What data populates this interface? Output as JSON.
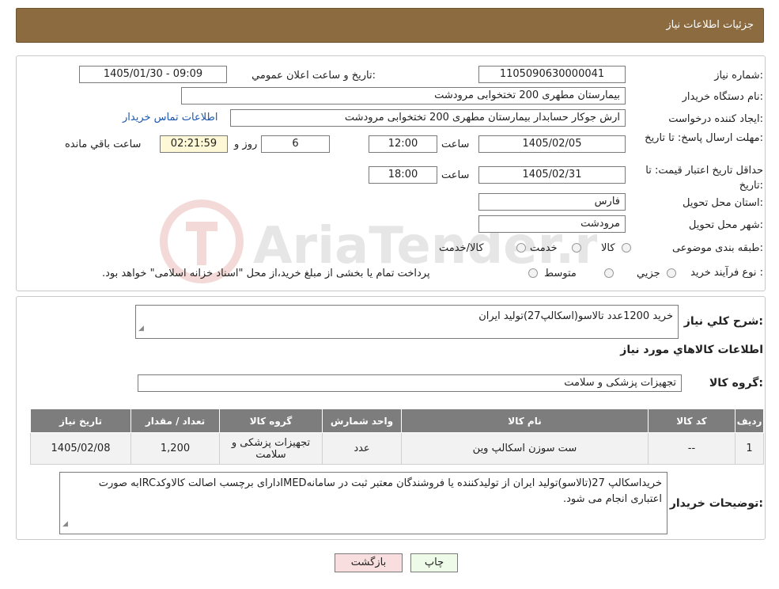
{
  "header": {
    "title": "جزئیات اطلاعات نیاز"
  },
  "form": {
    "need_number_label": "شماره نیاز:",
    "need_number": "1105090630000041",
    "announce_label": "تاریخ و ساعت اعلان عمومي:",
    "announce_value": "1405/01/30 - 09:09",
    "buyer_org_label": "نام دستگاه خريدار:",
    "buyer_org": "بیمارستان مطهری  200 تختخوابی مرودشت",
    "creator_label": "ايجاد كننده درخواست:",
    "creator": "ارش  جوکار حسابدار بیمارستان مطهری  200 تختخوابی مرودشت",
    "contact_link": "اطلاعات تماس خريدار",
    "deadline_label": "مهلت ارسال پاسخ: تا تاريخ:",
    "deadline_date": "1405/02/05",
    "time_label": "ساعت",
    "deadline_time": "12:00",
    "days_value": "6",
    "days_label": "روز و",
    "remaining_time": "02:21:59",
    "remaining_label": "ساعت باقي مانده",
    "validity_label": "حداقل تاريخ اعتبار قيمت: تا تاريخ:",
    "validity_date": "1405/02/31",
    "validity_time": "18:00",
    "province_label": "استان محل تحويل:",
    "province": "فارس",
    "city_label": "شهر محل تحويل:",
    "city": "مرودشت",
    "category_label": "طبقه بندی موضوعی:",
    "category_options": [
      "کالا",
      "خدمت",
      "کالا/خدمت"
    ],
    "process_label": "نوع فرآيند خريد :",
    "process_options": [
      "جزيي",
      "متوسط"
    ],
    "process_note": "پرداخت تمام يا بخشی از مبلغ خريد،از محل \"اسناد خزانه اسلامی\" خواهد بود."
  },
  "details": {
    "summary_label": "شرح كلي نياز:",
    "summary": "خرید 1200عدد تالاسو(اسکالپ27)تولید ایران",
    "items_heading": "اطلاعات كالاهاي مورد نياز",
    "group_label": "گروه كالا:",
    "group_value": "تجهیزات پزشکی و سلامت",
    "table": {
      "headers": [
        "رديف",
        "كد كالا",
        "نام كالا",
        "واحد شمارش",
        "گروه كالا",
        "تعداد / مقدار",
        "تاريخ نياز"
      ],
      "rows": [
        [
          "1",
          "--",
          "ست سوزن اسکالپ وین",
          "عدد",
          "تجهیزات پزشکی و سلامت",
          "1,200",
          "1405/02/08"
        ]
      ]
    },
    "buyer_notes_label": "توضيحات خريدار:",
    "buyer_notes": "خریداسکالپ 27(تالاسو)تولید ایران از تولیدکننده یا فروشندگان معتبر ثبت در سامانهIMEDدارای برچسب اصالت کالاوکدIRCبه صورت اعتباری انجام می شود."
  },
  "buttons": {
    "back": "بازگشت",
    "print": "چاپ"
  },
  "watermark_text": "AriaTender.neT"
}
